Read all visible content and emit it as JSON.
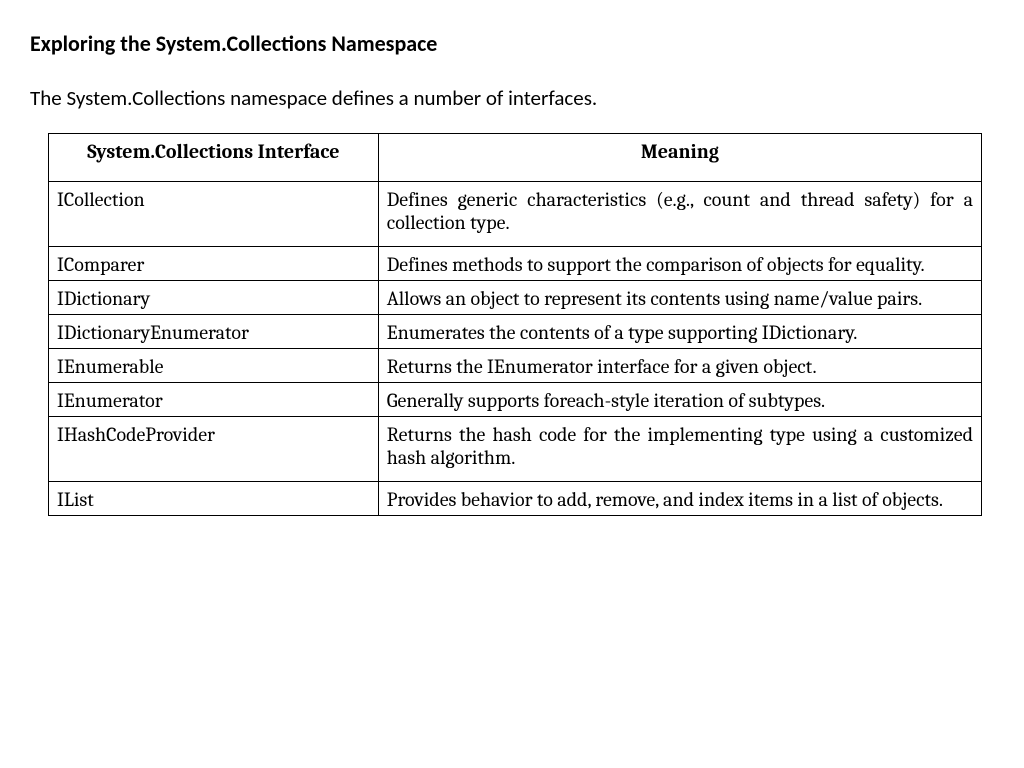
{
  "heading": "Exploring the System.Collections Namespace",
  "intro": "The System.Collections namespace defines a number of interfaces.",
  "table": {
    "header_interface": "System.Collections Interface",
    "header_meaning": "Meaning",
    "rows": [
      {
        "interface": "ICollection",
        "meaning": "Defines generic characteristics (e.g., count and thread safety) for a collection type."
      },
      {
        "interface": "IComparer",
        "meaning": "Defines methods to support the comparison of objects for equality."
      },
      {
        "interface": "IDictionary",
        "meaning": "Allows an object to represent its contents using name/value pairs."
      },
      {
        "interface": "IDictionaryEnumerator",
        "meaning": "Enumerates the contents of a type supporting IDictionary."
      },
      {
        "interface": "IEnumerable",
        "meaning": "Returns the IEnumerator interface for a given object."
      },
      {
        "interface": "IEnumerator",
        "meaning": "Generally supports foreach-style iteration of subtypes."
      },
      {
        "interface": "IHashCodeProvider",
        "meaning": "Returns the hash code for the implementing type using a customized hash algorithm."
      },
      {
        "interface": "IList",
        "meaning": "Provides behavior to add, remove, and index items in a list of objects."
      }
    ]
  }
}
